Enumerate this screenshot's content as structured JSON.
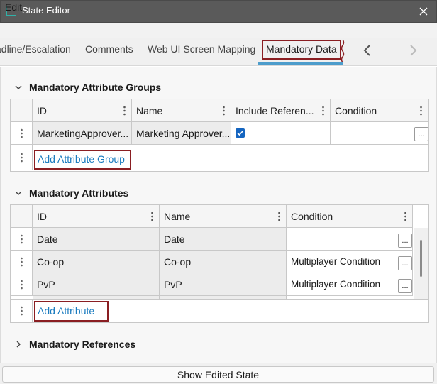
{
  "window": {
    "title": "State Editor"
  },
  "menu": {
    "edit": "Edit"
  },
  "tabs": [
    {
      "label": "adline/Escalation"
    },
    {
      "label": "Comments"
    },
    {
      "label": "Web UI Screen Mapping"
    },
    {
      "label": "Mandatory Data",
      "active": true
    }
  ],
  "sections": {
    "groups": {
      "title": "Mandatory Attribute Groups",
      "expanded": true,
      "columns": [
        "ID",
        "Name",
        "Include Referen...",
        "Condition"
      ],
      "rows": [
        {
          "id": "MarketingApprover...",
          "name": "Marketing Approver...",
          "include_references": true,
          "condition": ""
        }
      ],
      "add_label": "Add Attribute Group"
    },
    "attributes": {
      "title": "Mandatory Attributes",
      "expanded": true,
      "columns": [
        "ID",
        "Name",
        "Condition"
      ],
      "rows": [
        {
          "id": "Date",
          "name": "Date",
          "condition": ""
        },
        {
          "id": "Co-op",
          "name": "Co-op",
          "condition": "Multiplayer Condition"
        },
        {
          "id": "PvP",
          "name": "PvP",
          "condition": "Multiplayer Condition"
        }
      ],
      "add_label": "Add Attribute"
    },
    "references": {
      "title": "Mandatory References",
      "expanded": false
    }
  },
  "footer": {
    "show_edited_state": "Show Edited State"
  },
  "colors": {
    "accent": "#4d9dcc",
    "highlight_box": "#8a1e22",
    "link": "#1a7bbf",
    "app_icon": "#2fb1a8",
    "checkbox": "#1565c0"
  },
  "icons": {
    "app": "app-window-icon",
    "close": "close-icon",
    "tab_prev": "chevron-left-icon",
    "tab_next": "chevron-right-icon"
  },
  "ellipsis": "..."
}
